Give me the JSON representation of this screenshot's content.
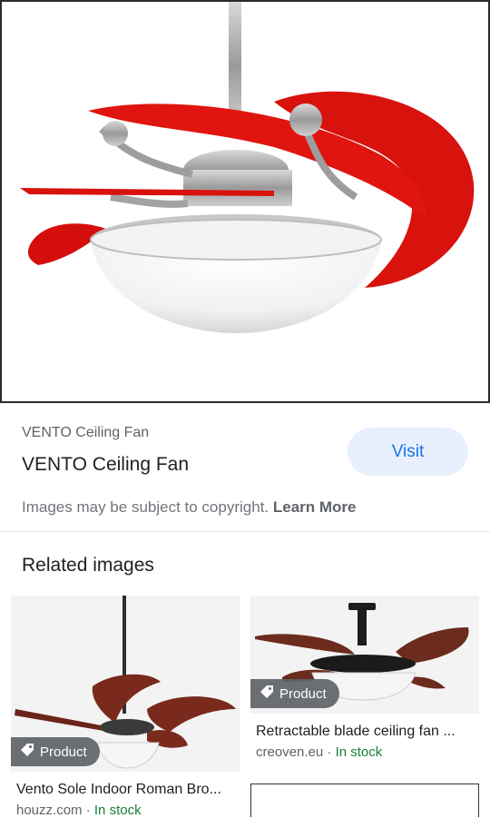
{
  "hero": {
    "alt": "VENTO Ceiling Fan"
  },
  "result": {
    "source": "VENTO Ceiling Fan",
    "title": "VENTO Ceiling Fan",
    "visit_label": "Visit"
  },
  "copyright": {
    "text": "Images may be subject to copyright.",
    "learn_more": "Learn More"
  },
  "related": {
    "heading": "Related images",
    "items": [
      {
        "badge": "Product",
        "title": "Vento Sole Indoor Roman Bro...",
        "domain": "houzz.com",
        "separator": " · ",
        "stock": "In stock"
      },
      {
        "badge": "Product",
        "title": "Retractable blade ceiling fan ...",
        "domain": "creoven.eu",
        "separator": " · ",
        "stock": "In stock"
      }
    ]
  },
  "colors": {
    "accent": "#1a73e8",
    "visit_bg": "#e8f0fe",
    "stock": "#188038",
    "blade_red": "#d8120d",
    "blade_brown": "#7a2a1c"
  }
}
